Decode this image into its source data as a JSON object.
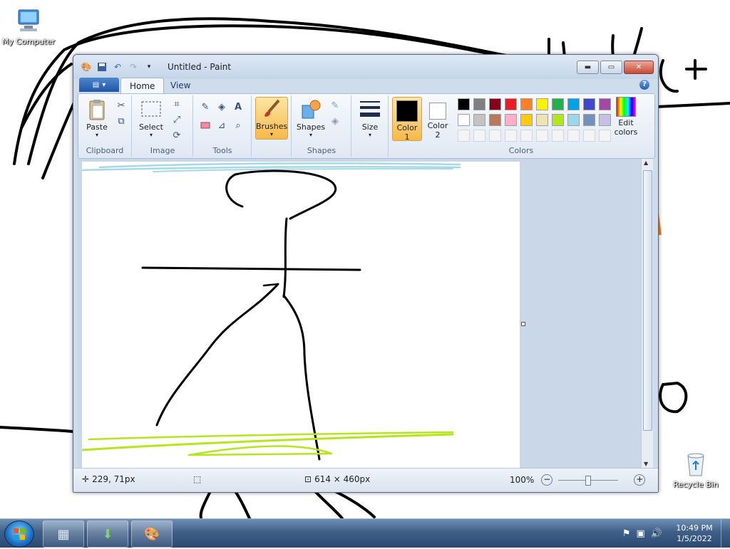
{
  "desktop": {
    "icons": [
      {
        "label": "My Computer",
        "icon": "computer-icon"
      },
      {
        "label": "Recycle Bin",
        "icon": "recycle-bin-icon"
      }
    ]
  },
  "window": {
    "title": "Untitled - Paint",
    "controls": {
      "minimize": "minimize",
      "maximize": "maximize",
      "close": "close"
    }
  },
  "tabs": [
    {
      "label": "Home",
      "active": true
    },
    {
      "label": "View",
      "active": false
    }
  ],
  "ribbon": {
    "groups": {
      "clipboard": "Clipboard",
      "image": "Image",
      "tools": "Tools",
      "shapes": "Shapes",
      "colors": "Colors"
    },
    "buttons": {
      "paste": "Paste",
      "select": "Select",
      "brushes": "Brushes",
      "shapes": "Shapes",
      "size": "Size",
      "color1_a": "Color",
      "color1_b": "1",
      "color2_a": "Color",
      "color2_b": "2",
      "edit_colors_a": "Edit",
      "edit_colors_b": "colors"
    },
    "active_colors": {
      "color1": "#000000",
      "color2": "#ffffff"
    },
    "palette_row1": [
      "#000000",
      "#7f7f7f",
      "#880015",
      "#ed1c24",
      "#ff7f27",
      "#fff200",
      "#22b14c",
      "#00a2e8",
      "#3f48cc",
      "#a349a4"
    ],
    "palette_row2": [
      "#ffffff",
      "#c3c3c3",
      "#b97a57",
      "#ffaec9",
      "#ffc90e",
      "#efe4b0",
      "#b5e61d",
      "#99d9ea",
      "#7092be",
      "#c8bfe7"
    ],
    "palette_row3": [
      "#f4f4f4",
      "#f4f4f4",
      "#f4f4f4",
      "#f4f4f4",
      "#f4f4f4",
      "#f4f4f4",
      "#f4f4f4",
      "#f4f4f4",
      "#f4f4f4",
      "#f4f4f4"
    ]
  },
  "status": {
    "cursor_pos": "229, 71px",
    "canvas_size": "614 × 460px",
    "zoom": "100%"
  },
  "taskbar": {
    "time": "10:49 PM",
    "date": "1/5/2022"
  }
}
